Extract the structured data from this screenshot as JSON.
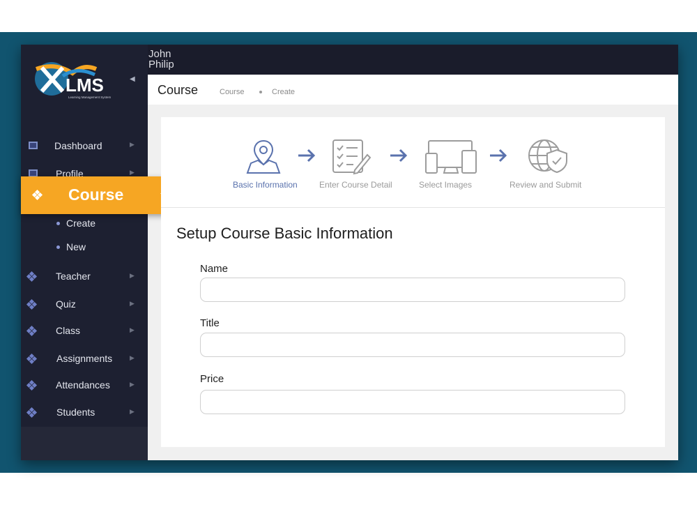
{
  "app": {
    "logo_text": "LMS",
    "logo_tagline": "Learning Management System",
    "user_name": "John Philip"
  },
  "header": {
    "title": "Course",
    "breadcrumb": [
      "Course",
      "Create"
    ]
  },
  "sidebar": {
    "items": [
      {
        "label": "Dashboard"
      },
      {
        "label": "Profile"
      },
      {
        "label": "Course",
        "active": true,
        "subitems": [
          "Create",
          "New"
        ]
      },
      {
        "label": "Teacher"
      },
      {
        "label": "Quiz"
      },
      {
        "label": "Class"
      },
      {
        "label": "Assignments"
      },
      {
        "label": "Attendances"
      },
      {
        "label": "Students"
      }
    ]
  },
  "wizard": {
    "steps": [
      {
        "label": "Basic Information",
        "icon": "map-pin-icon",
        "active": true
      },
      {
        "label": "Enter Course Detail",
        "icon": "checklist-icon",
        "active": false
      },
      {
        "label": "Select Images",
        "icon": "devices-icon",
        "active": false
      },
      {
        "label": "Review and Submit",
        "icon": "globe-shield-icon",
        "active": false
      }
    ]
  },
  "form": {
    "title": "Setup Course Basic Information",
    "fields": [
      {
        "label": "Name",
        "value": ""
      },
      {
        "label": "Title",
        "value": ""
      },
      {
        "label": "Price",
        "value": ""
      }
    ]
  },
  "colors": {
    "accent": "#f6a623",
    "sidebar": "#1d2031",
    "active_step": "#5a72ad",
    "background_frame": "#11546f"
  }
}
